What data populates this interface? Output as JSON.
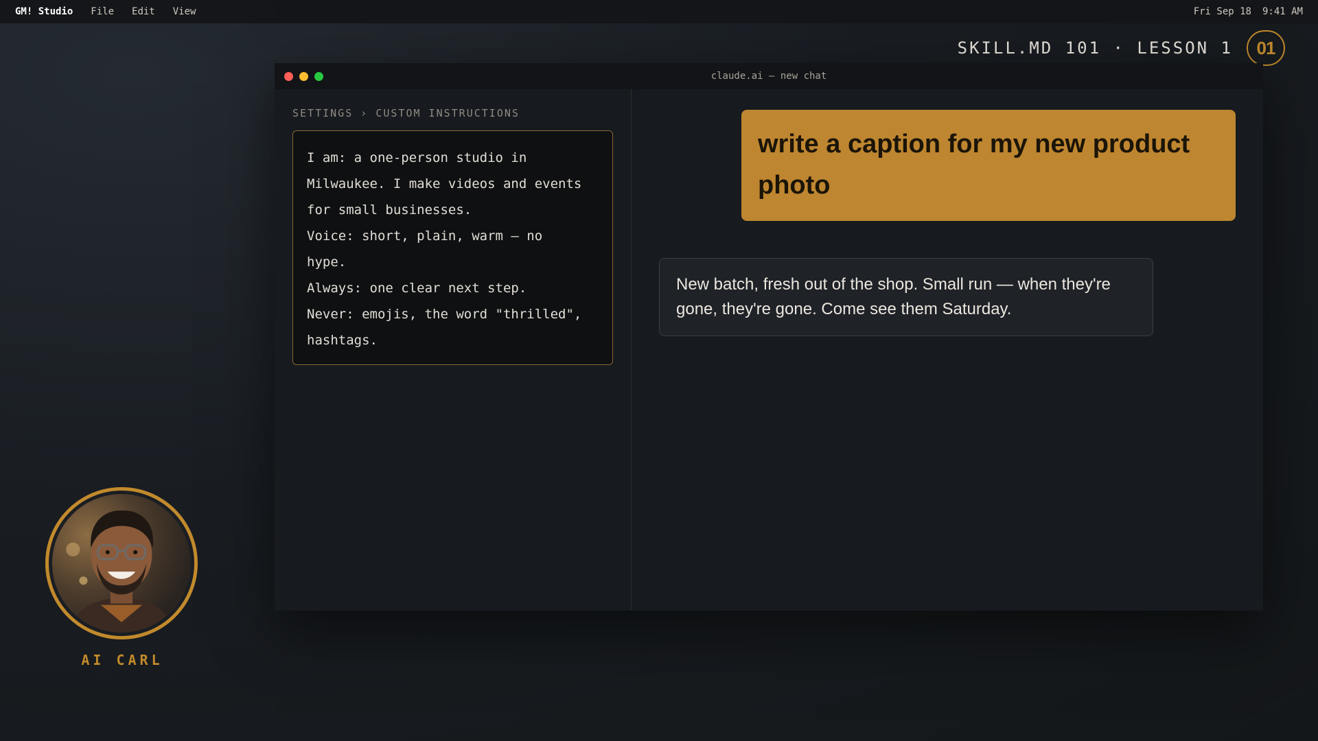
{
  "menubar": {
    "app_name": "GM! Studio",
    "menus": [
      "File",
      "Edit",
      "View"
    ],
    "date": "Fri Sep 18",
    "time": "9:41 AM"
  },
  "lesson": {
    "title": "SKILL.MD 101 · LESSON 1",
    "number": "01"
  },
  "window": {
    "title": "claude.ai — new chat"
  },
  "settings": {
    "breadcrumb": "SETTINGS › CUSTOM INSTRUCTIONS",
    "instructions": [
      "I am: a one-person studio in\nMilwaukee. I make videos and events\nfor small businesses.",
      "Voice: short, plain, warm — no\nhype.",
      "Always: one clear next step.",
      "Never: emojis, the word \"thrilled\",\nhashtags."
    ]
  },
  "chat": {
    "user_message": "write a caption for my new product photo",
    "ai_reply": "New batch, fresh out of the shop. Small run — when they're gone, they're gone. Come see them Saturday."
  },
  "presenter": {
    "name": "AI CARL"
  },
  "colors": {
    "accent": "#c28a2c",
    "user_bubble": "#be8630"
  }
}
